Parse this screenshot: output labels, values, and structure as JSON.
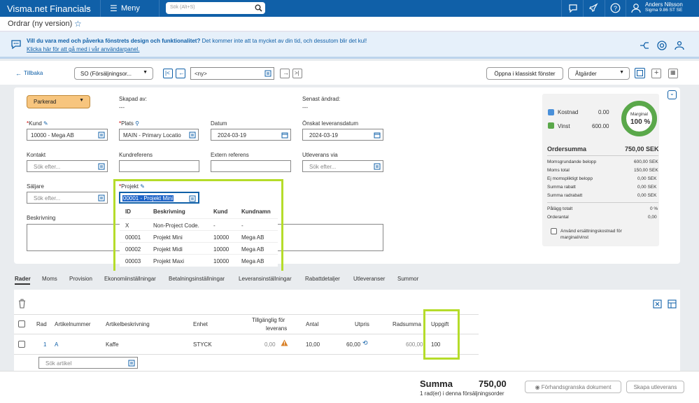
{
  "app": {
    "brand": "Visma.net Financials",
    "menu": "Meny",
    "search_placeholder": "Sök (Alt+S)",
    "user_name": "Anders Nilsson",
    "user_company": "Sigma 9.86 ST SE"
  },
  "page": {
    "title": "Ordrar (ny version)"
  },
  "banner": {
    "question": "Vill du vara med och påverka fönstrets design och funktionalitet?",
    "note": "Det kommer inte att ta mycket av din tid, och dessutom blir det kul!",
    "link": "Klicka här för att gå med i vår användarpanel."
  },
  "toolbar": {
    "back": "Tillbaka",
    "order_type": "SO (Försäljningsor...",
    "order_nbr": "<ny>",
    "classic": "Öppna i klassiskt fönster",
    "actions": "Åtgärder"
  },
  "form": {
    "status": "Parkerad",
    "created_label": "Skapad av:",
    "created_value": "---",
    "changed_label": "Senast ändrad:",
    "changed_value": "---",
    "kund_label": "Kund",
    "kund_value": "10000 - Mega AB",
    "plats_label": "Plats",
    "plats_value": "MAIN - Primary Locatio",
    "datum_label": "Datum",
    "datum_value": "2024-03-19",
    "onskat_label": "Önskat leveransdatum",
    "onskat_value": "2024-03-19",
    "kontakt_label": "Kontakt",
    "kontakt_placeholder": "Sök efter...",
    "kundref_label": "Kundreferens",
    "extref_label": "Extern referens",
    "utlev_label": "Utleverans via",
    "utlev_placeholder": "Sök efter...",
    "saljare_label": "Säljare",
    "saljare_placeholder": "Sök efter...",
    "projekt_label": "Projekt",
    "projekt_value": "00001 - Projekt Mini",
    "beskrivning_label": "Beskrivning"
  },
  "dropdown": {
    "headers": [
      "ID",
      "Beskrivning",
      "Kund",
      "Kundnamn"
    ],
    "rows": [
      [
        "X",
        "Non-Project Code.",
        "-",
        "-"
      ],
      [
        "00001",
        "Projekt Mini",
        "10000",
        "Mega AB"
      ],
      [
        "00002",
        "Projekt Midi",
        "10000",
        "Mega AB"
      ],
      [
        "00003",
        "Projekt Maxi",
        "10000",
        "Mega AB"
      ]
    ]
  },
  "summary": {
    "kostnad_label": "Kostnad",
    "kostnad_value": "0.00",
    "vinst_label": "Vinst",
    "vinst_value": "600.00",
    "marginal_label": "Marginal",
    "marginal_value": "100 %",
    "marginal_fraction": 1.0,
    "ordersumma_label": "Ordersumma",
    "ordersumma_value": "750,00 SEK",
    "lines": [
      [
        "Momsgrundande belopp",
        "600,00 SEK"
      ],
      [
        "Moms total",
        "150,00 SEK"
      ],
      [
        "Ej momspliktigt belopp",
        "0,00 SEK"
      ],
      [
        "Summa rabatt",
        "0,00 SEK"
      ],
      [
        "Summa radrabatt",
        "0,00 SEK"
      ]
    ],
    "lines2": [
      [
        "Pålägg totalt",
        "0 %"
      ],
      [
        "Orderantal",
        "0,00"
      ]
    ],
    "checkbox_label": "Använd ersättningskostnad för marginal/vinst",
    "colors": {
      "kostnad": "#4a90d9",
      "vinst": "#5aa84a"
    }
  },
  "tabs": [
    "Rader",
    "Moms",
    "Provision",
    "Ekonomiinställningar",
    "Betalningsinställningar",
    "Leveransinställningar",
    "Rabattdetaljer",
    "Utleveranser",
    "Summor"
  ],
  "grid": {
    "headers": {
      "rad": "Rad",
      "artnr": "Artikelnummer",
      "artbesk": "Artikelbeskrivning",
      "enhet": "Enhet",
      "tillg1": "Tillgänglig för",
      "tillg2": "leverans",
      "antal": "Antal",
      "utpris": "Utpris",
      "radsumma": "Radsumma",
      "uppgift": "Uppgift"
    },
    "row": {
      "rad": "1",
      "artnr": "A",
      "artbesk": "Kaffe",
      "enhet": "STYCK",
      "tillg": "0,00",
      "antal": "10,00",
      "utpris": "60,00",
      "radsumma": "600,00",
      "uppgift": "100"
    },
    "search_placeholder": "Sök artikel"
  },
  "footer": {
    "summa_label": "Summa",
    "summa_value": "750,00",
    "rows_info": "1 rad(er) i denna försäljningsorder",
    "preview": "Förhandsgranska dokument",
    "create": "Skapa utleverans"
  }
}
